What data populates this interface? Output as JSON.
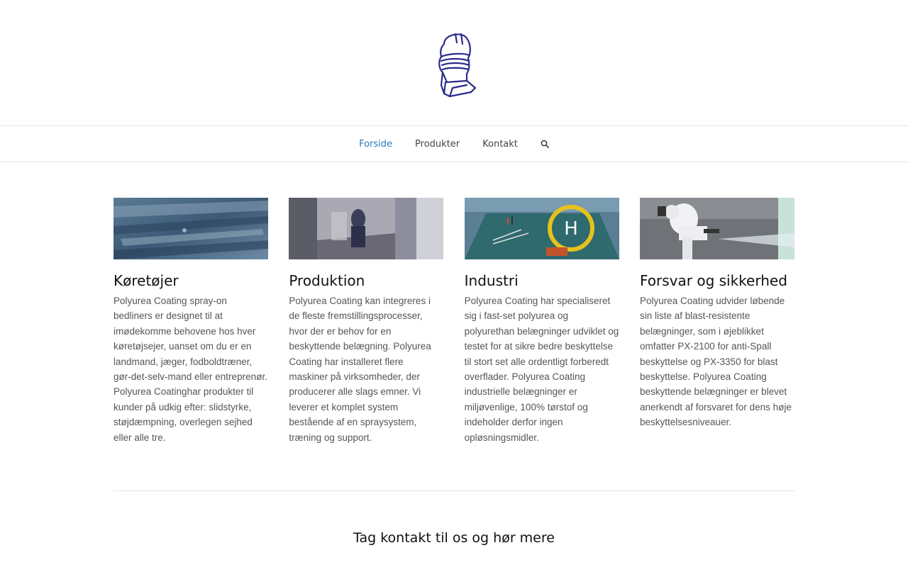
{
  "brand": {
    "logo": "knight-helmet-icon",
    "color": "#2a2a8c"
  },
  "nav": {
    "items": [
      {
        "label": "Forside",
        "active": true
      },
      {
        "label": "Produkter",
        "active": false
      },
      {
        "label": "Kontakt",
        "active": false
      }
    ],
    "search_icon": "search-icon",
    "active_color": "#2b78b8"
  },
  "features": [
    {
      "title": "Køretøjer",
      "image": "truck-bedliner-photo",
      "text": "Polyurea Coating spray-on bedliners er designet til at imødekomme behovene hos hver køretøjsejer, uanset om du er en landmand, jæger, fodboldtræner, gør-det-selv-mand eller entreprenør. Polyurea Coatinghar produkter til kunder på udkig efter: slidstyrke, støjdæmpning, overlegen sejhed eller alle tre."
    },
    {
      "title": "Produktion",
      "image": "spray-booth-photo",
      "text": "Polyurea Coating kan integreres i de fleste fremstillingsprocesser, hvor der er behov for en beskyttende belægning. Polyurea Coating har installeret flere maskiner på virksomheder, der producerer alle slags emner. Vi leverer et komplet system bestående af en spraysystem, træning og support."
    },
    {
      "title": "Industri",
      "image": "helipad-photo",
      "text": "Polyurea Coating har specialiseret sig i fast-set polyurea og polyurethan belægninger udviklet og testet for at sikre bedre beskyttelse til stort set alle ordentligt forberedt overflader. Polyurea Coating industrielle belægninger er miljøvenlige, 100% tørstof og indeholder derfor ingen opløsningsmidler."
    },
    {
      "title": "Forsvar og sikkerhed",
      "image": "protective-suit-spray-photo",
      "text": "Polyurea Coating udvider løbende sin liste af blast-resistente belægninger, som i øjeblikket omfatter PX-2100 for anti-Spall beskyttelse og PX-3350 for blast beskyttelse. Polyurea Coating beskyttende belægninger er blevet anerkendt af forsvaret for dens høje beskyttelsesniveauer."
    }
  ],
  "cta": {
    "title": "Tag kontakt til os og hør mere"
  }
}
